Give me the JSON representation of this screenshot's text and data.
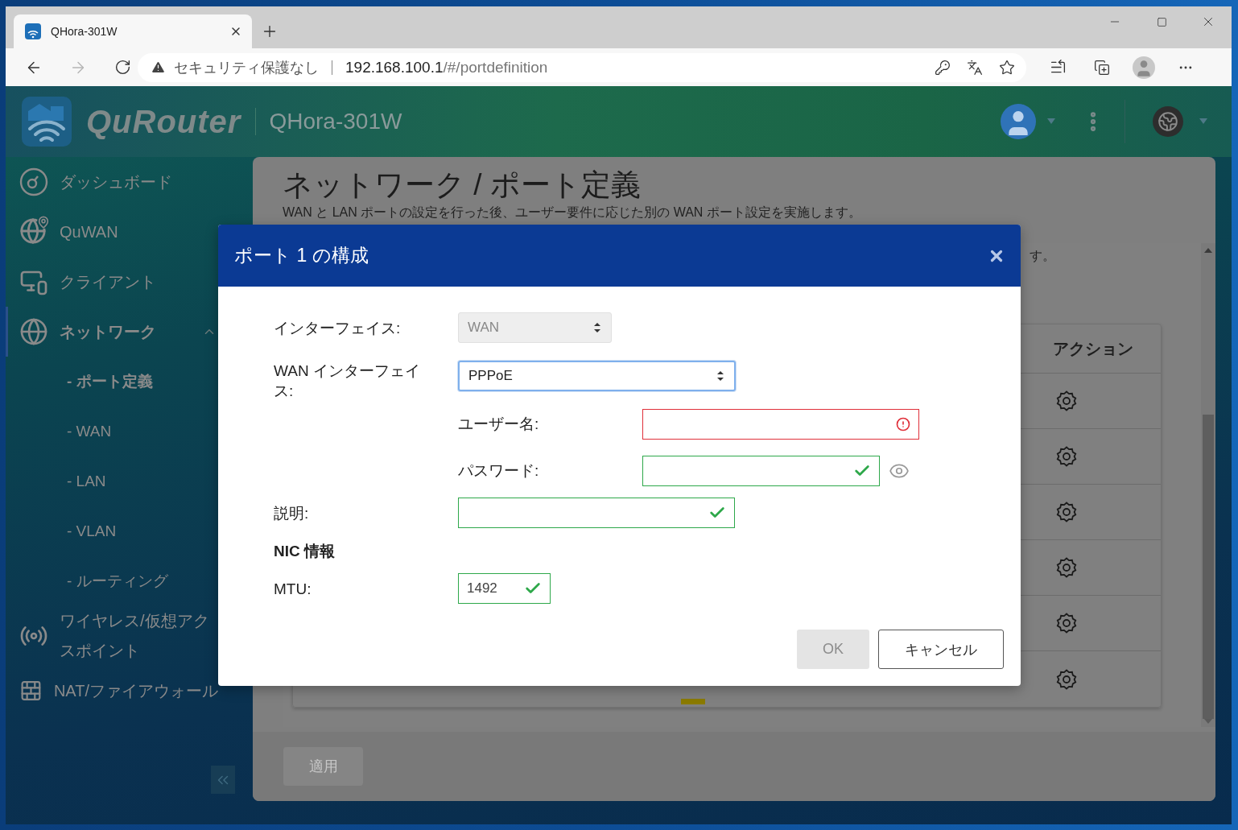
{
  "browser": {
    "tab_title": "QHora-301W",
    "security_label": "セキュリティ保護なし",
    "url_host": "192.168.100.1",
    "url_path": "/#/portdefinition"
  },
  "header": {
    "logo_text": "QuRouter",
    "device_name": "QHora-301W"
  },
  "sidebar": {
    "items": [
      {
        "label": "ダッシュボード",
        "selected": false
      },
      {
        "label": "QuWAN",
        "selected": false
      },
      {
        "label": "クライアント",
        "selected": false
      },
      {
        "label": "ネットワーク",
        "selected": true,
        "expanded": true,
        "children": [
          {
            "label": "- ポート定義",
            "selected": true
          },
          {
            "label": "- WAN",
            "selected": false
          },
          {
            "label": "- LAN",
            "selected": false
          },
          {
            "label": "- VLAN",
            "selected": false
          },
          {
            "label": "- ルーティング",
            "selected": false
          }
        ]
      },
      {
        "lines": [
          "ワイヤレス/仮想アク",
          "スポイント"
        ],
        "selected": false
      },
      {
        "label": "NAT/ファイアウォール",
        "selected": false
      }
    ]
  },
  "page": {
    "title": "ネットワーク / ポート定義",
    "description": "WAN と LAN ポートの設定を行った後、ユーザー要件に応じた別の WAN ポート設定を実施します。",
    "note_fragment": "す。",
    "table": {
      "columns": [
        "アクション"
      ]
    },
    "apply_button": {
      "label": "適用",
      "disabled": true
    }
  },
  "dialog": {
    "title": "ポート 1 の構成",
    "fields": [
      {
        "kind": "select",
        "label": "インターフェイス:",
        "value": "WAN",
        "disabled": true,
        "focused": false
      },
      {
        "kind": "select",
        "label": "WAN インターフェイス:",
        "value": "PPPoE",
        "disabled": false,
        "focused": true,
        "subfields": [
          {
            "kind": "text",
            "label": "ユーザー名:",
            "valid": false
          },
          {
            "kind": "password",
            "label": "パスワード:",
            "valid": true
          }
        ]
      },
      {
        "kind": "text",
        "label": "説明:",
        "valid": true
      },
      {
        "kind": "heading",
        "label": "NIC 情報"
      },
      {
        "kind": "number",
        "label": "MTU:",
        "value": "1492",
        "valid": true
      }
    ],
    "buttons": [
      {
        "label": "OK",
        "disabled": true
      },
      {
        "label": "キャンセル",
        "disabled": false
      }
    ]
  }
}
